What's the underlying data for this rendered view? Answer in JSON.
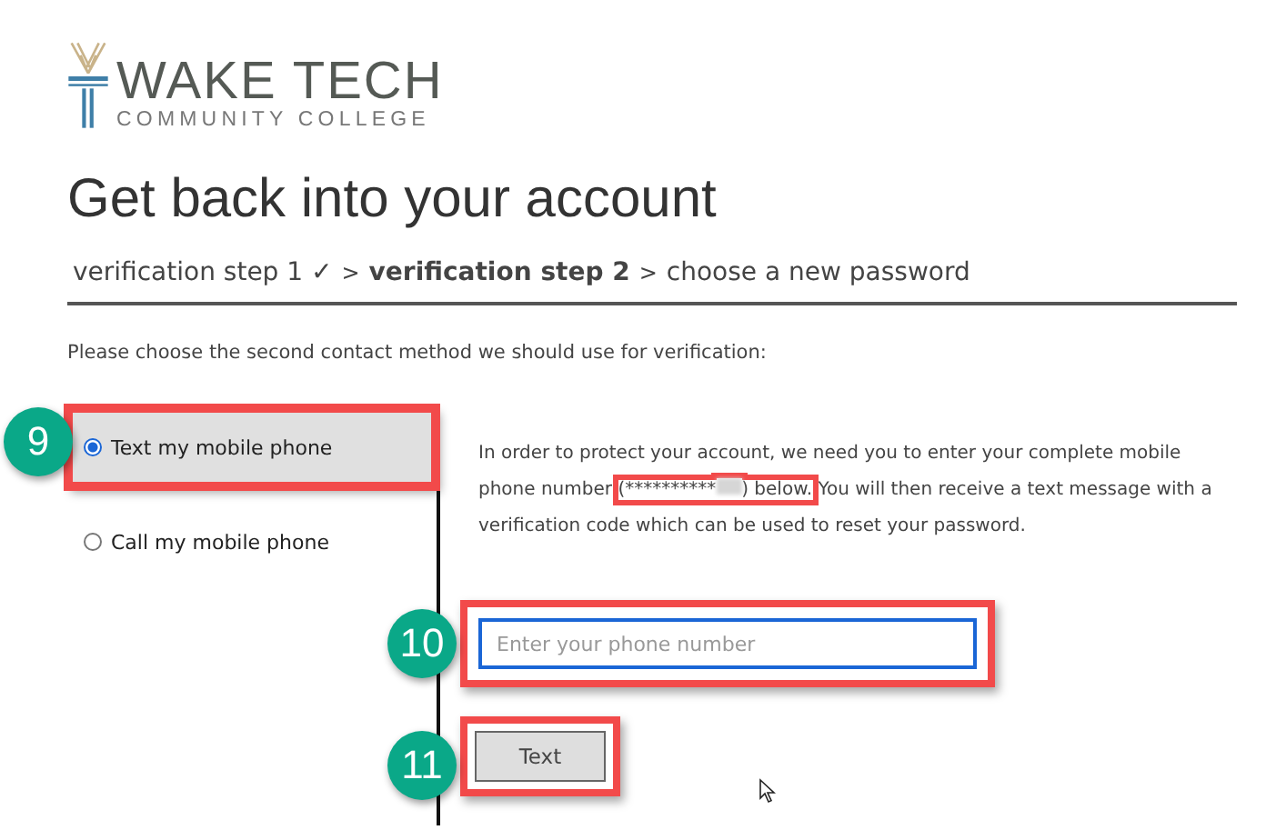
{
  "logo": {
    "name": "WAKE TECH",
    "tagline": "COMMUNITY COLLEGE"
  },
  "title": "Get back into your account",
  "breadcrumb": [
    {
      "kind": "step",
      "label": "verification step 1 ✓",
      "current": false
    },
    {
      "kind": "separator",
      "label": ">"
    },
    {
      "kind": "step",
      "label": "verification step 2",
      "current": true
    },
    {
      "kind": "separator",
      "label": ">"
    },
    {
      "kind": "step",
      "label": "choose a new password",
      "current": false
    }
  ],
  "instruction": "Please choose the second contact method we should use for verification:",
  "methods": [
    {
      "label": "Text my mobile phone",
      "selected": true,
      "callout": "9"
    },
    {
      "label": "Call my mobile phone",
      "selected": false
    }
  ],
  "message": {
    "before": "In order to protect your account, we need you to enter your complete mobile phone number ",
    "masked": "(**********",
    "after_mask": ") below.",
    "after": " You will then receive a text message with a verification code which can be used to reset your password."
  },
  "phone_field": {
    "placeholder": "Enter your phone number",
    "callout": "10"
  },
  "submit_button": {
    "label": "Text",
    "callout": "11"
  }
}
